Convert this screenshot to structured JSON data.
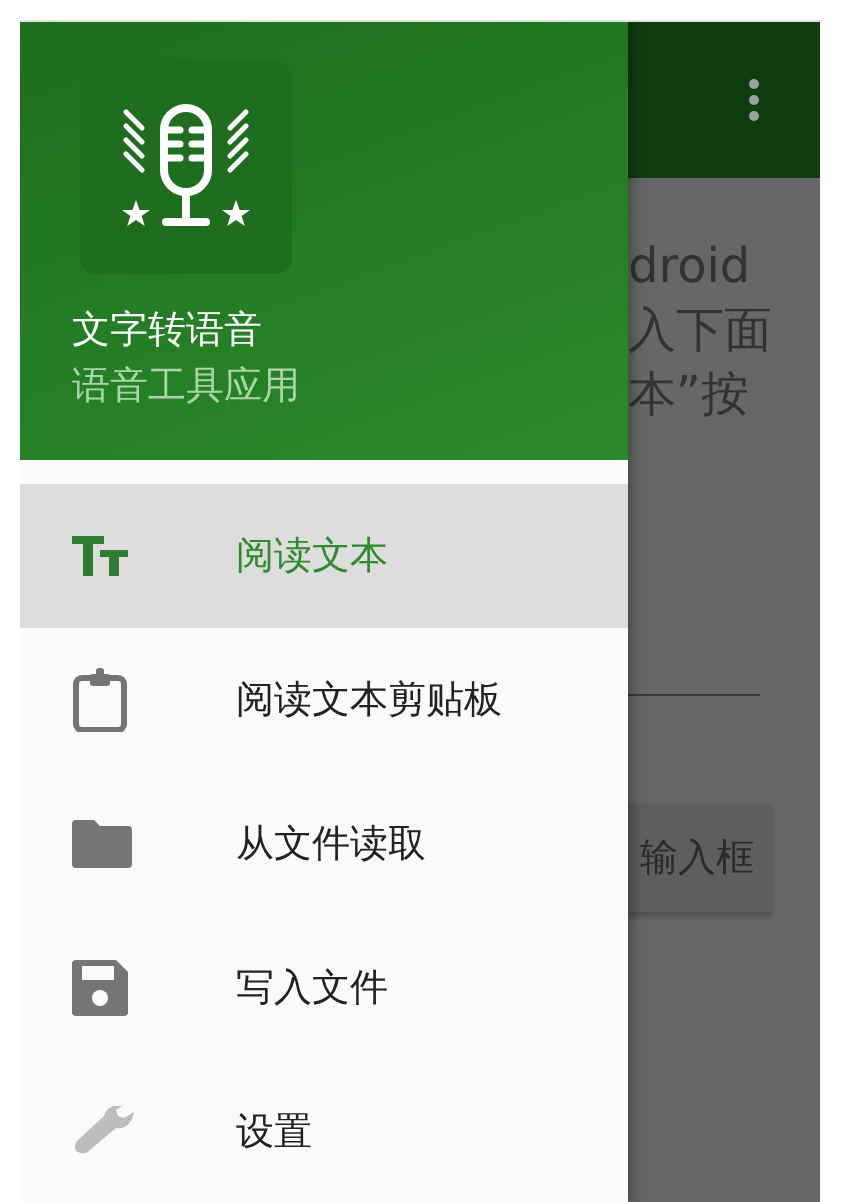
{
  "app": {
    "content": {
      "lines": [
        "droid",
        "入下面",
        "本”按"
      ],
      "button": "输入框"
    }
  },
  "drawer": {
    "header": {
      "title": "文字转语音",
      "subtitle": "语音工具应用"
    },
    "items": [
      {
        "label": "阅读文本",
        "selected": true
      },
      {
        "label": "阅读文本剪贴板",
        "selected": false
      },
      {
        "label": "从文件读取",
        "selected": false
      },
      {
        "label": "写入文件",
        "selected": false
      },
      {
        "label": "设置",
        "selected": false
      }
    ]
  }
}
